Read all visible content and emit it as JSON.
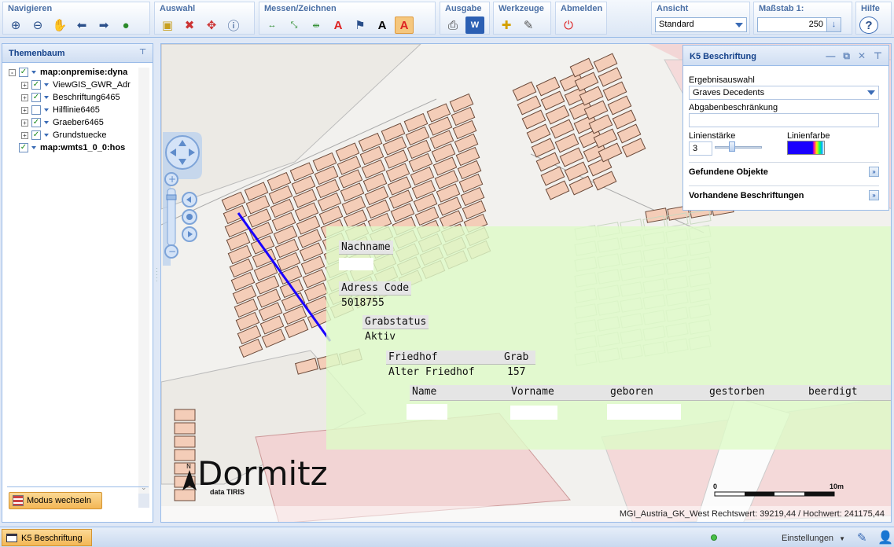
{
  "toolbar": {
    "groups": [
      {
        "title": "Navigieren",
        "icons": [
          "zoom-in-icon",
          "zoom-out-icon",
          "pan-hand-icon",
          "back-arrow-icon",
          "forward-arrow-icon",
          "globe-icon"
        ]
      },
      {
        "title": "Auswahl",
        "icons": [
          "select-rect-icon",
          "deselect-icon",
          "select-point-icon",
          "info-icon"
        ]
      },
      {
        "title": "Messen/Zeichnen",
        "icons": [
          "measure-line-icon",
          "measure-area-icon",
          "measure-add-icon",
          "text-red-icon",
          "flag-icon",
          "text-box-icon",
          "text-format-icon"
        ]
      },
      {
        "title": "Ausgabe",
        "icons": [
          "print-icon",
          "word-export-icon"
        ]
      },
      {
        "title": "Werkzeuge",
        "icons": [
          "tool-star-icon",
          "tool-edit-icon"
        ]
      },
      {
        "title": "Abmelden",
        "icons": [
          "power-icon"
        ]
      }
    ],
    "ansicht": {
      "title": "Ansicht",
      "value": "Standard"
    },
    "massstab": {
      "title": "Maßstab 1:",
      "value": "250"
    },
    "hilfe": {
      "title": "Hilfe",
      "icon": "help-icon"
    }
  },
  "themenbaum": {
    "title": "Themenbaum",
    "items": [
      {
        "label": "map:onpremise:dyna",
        "checked": true,
        "bold": true,
        "level": 0,
        "expand": "-"
      },
      {
        "label": "ViewGIS_GWR_Adr",
        "checked": true,
        "bold": false,
        "level": 1,
        "expand": "+"
      },
      {
        "label": "Beschriftung6465",
        "checked": true,
        "bold": false,
        "level": 1,
        "expand": "+"
      },
      {
        "label": "Hilflinie6465",
        "checked": false,
        "bold": false,
        "level": 1,
        "expand": "+"
      },
      {
        "label": "Graeber6465",
        "checked": true,
        "bold": false,
        "level": 1,
        "expand": "+"
      },
      {
        "label": "Grundstuecke",
        "checked": true,
        "bold": false,
        "level": 1,
        "expand": "+"
      },
      {
        "label": "map:wmts1_0_0:hos",
        "checked": true,
        "bold": true,
        "level": 0,
        "expand": ""
      }
    ],
    "modus_button": "Modus wechseln"
  },
  "map": {
    "brand": "Dormitz",
    "brand_sub": "data TIRIS",
    "north": "N",
    "scale_start": "0",
    "scale_end": "10m",
    "coords": "MGI_Austria_GK_West Rechtswert: 39219,44 / Hochwert: 241175,44"
  },
  "popup": {
    "nachname_label": "Nachname",
    "adress_label": "Adress Code",
    "adress_value": "5018755",
    "grabstatus_label": "Grabstatus",
    "grabstatus_value": "Aktiv",
    "friedhof_label": "Friedhof",
    "grab_label": "Grab",
    "friedhof_value": "Alter Friedhof",
    "grab_value": "157",
    "table_headers": [
      "Name",
      "Vorname",
      "geboren",
      "gestorben",
      "beerdigt"
    ]
  },
  "k5": {
    "title": "K5 Beschriftung",
    "ergebnis_label": "Ergebnisauswahl",
    "ergebnis_value": "Graves Decedents",
    "abgaben_label": "Abgabenbeschränkung",
    "abgaben_value": "",
    "linienstaerke_label": "Linienstärke",
    "linienstaerke_value": "3",
    "linienfarbe_label": "Linienfarbe",
    "linienfarbe_color": "#1a00ff",
    "section1": "Gefundene Objekte",
    "section2": "Vorhandene Beschriftungen"
  },
  "bottombar": {
    "task_label": "K5 Beschriftung",
    "settings_label": "Einstellungen"
  },
  "colors": {
    "accent_orange": "#f3b755",
    "header_blue": "#15428b",
    "popup_green": "#defac8",
    "grave_fill": "#f4cdb8",
    "route_line": "#1a00ff"
  }
}
